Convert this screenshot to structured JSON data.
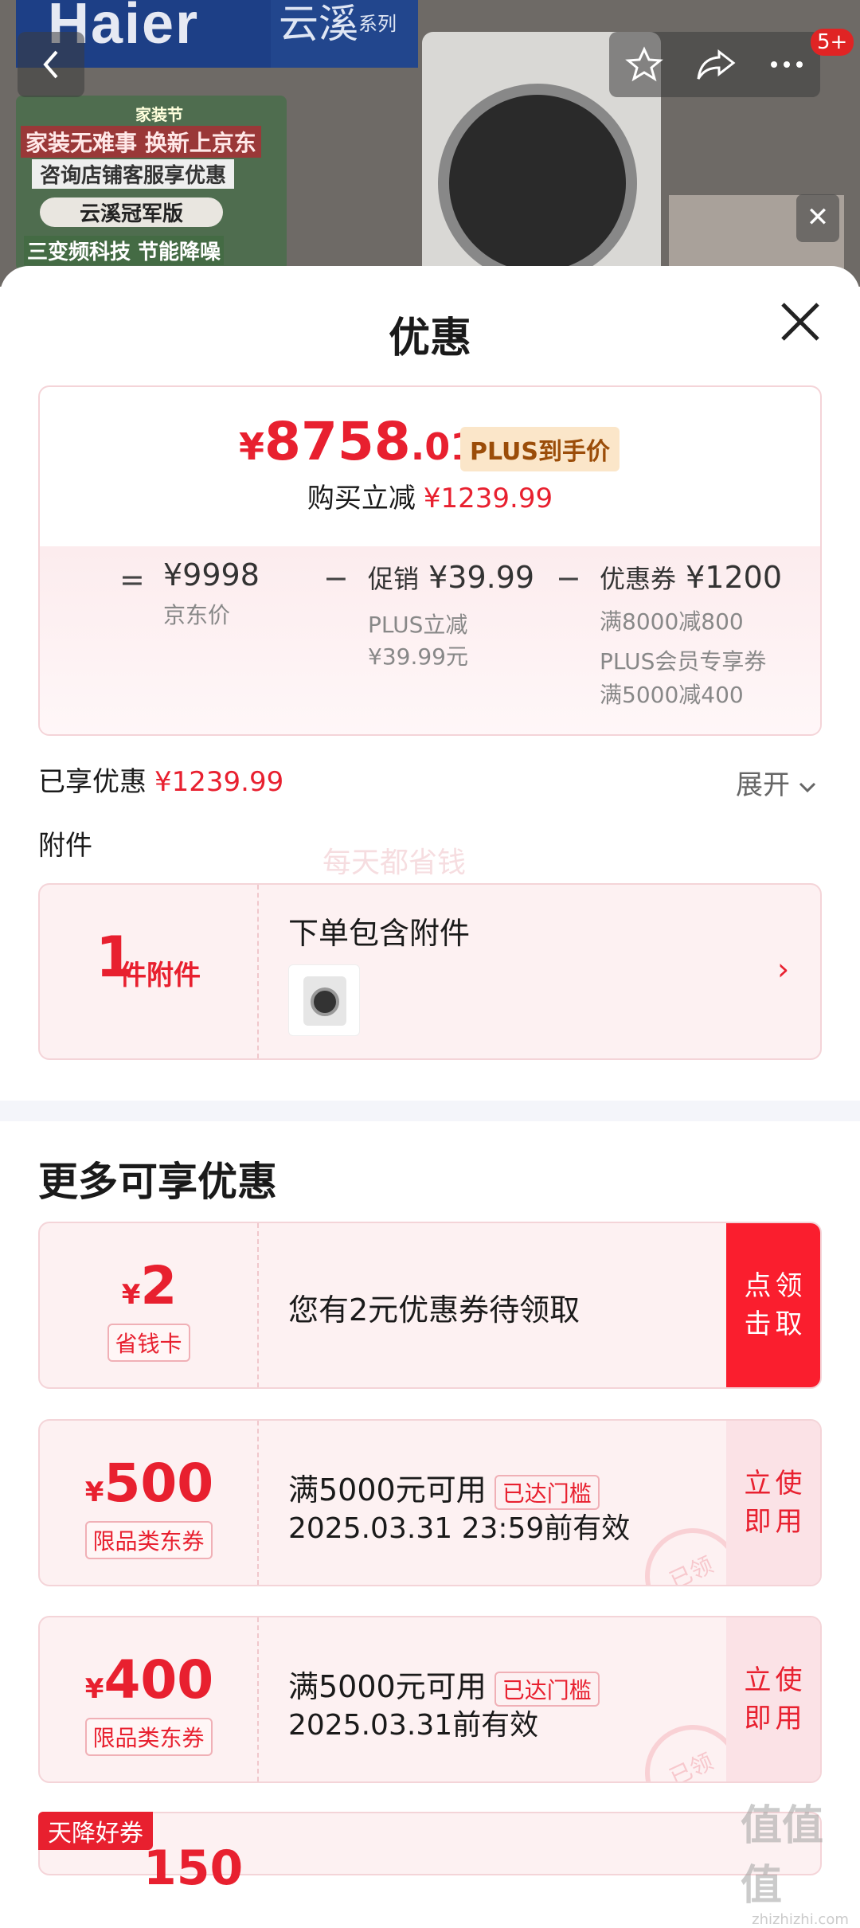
{
  "topbar": {
    "back_icon": "chevron-left-icon",
    "actions": [
      "star-icon",
      "share-icon",
      "more-icon"
    ],
    "message_badge": "5+",
    "banner_brand": "Haier",
    "banner_series": "云溪",
    "banner_series_suffix": "系列",
    "sign_lines": [
      "家装无难事 换新上京东",
      "咨询店铺客服享优惠",
      "云溪冠军版",
      "三变频科技 节能降噪"
    ],
    "sign_top": "家装节"
  },
  "sheet": {
    "title": "优惠",
    "price_card": {
      "currency": "¥",
      "final_int": "8758",
      "final_dec": ".01",
      "plus_tag": "PLUS到手价",
      "save_label": "购买立减",
      "save_value": "¥1239.99",
      "breakdown": {
        "eq": "=",
        "jd_price": "¥9998",
        "jd_price_label": "京东价",
        "minus1": "−",
        "promo_label": "促销",
        "promo_value": "¥39.99",
        "promo_sub1": "PLUS立减",
        "promo_sub2": "¥39.99元",
        "minus2": "−",
        "coupon_label": "优惠券",
        "coupon_value": "¥1200",
        "coupon_sub1": "满8000减800",
        "coupon_sub2": "PLUS会员专享券",
        "coupon_sub3": "满5000减400"
      }
    },
    "enjoyed_label": "已享优惠",
    "enjoyed_value": "¥1239.99",
    "expand_label": "展开",
    "attach_label": "附件",
    "attach_card": {
      "count": "1",
      "unit": "件附件",
      "title": "下单包含附件"
    },
    "watermark": "每天都省钱",
    "more_title": "更多可享优惠",
    "coupons": [
      {
        "symbol": "¥",
        "amount": "2",
        "kind": "省钱卡",
        "text": "您有2元优惠券待领取",
        "reached": "",
        "date": "",
        "action": "点击领取"
      },
      {
        "symbol": "¥",
        "amount": "500",
        "kind": "限品类东券",
        "text": "满5000元可用",
        "reached": "已达门槛",
        "date": "2025.03.31 23:59前有效",
        "action": "立即使用",
        "stamp": "已领"
      },
      {
        "symbol": "¥",
        "amount": "400",
        "kind": "限品类东券",
        "text": "满5000元可用",
        "reached": "已达门槛",
        "date": "2025.03.31前有效",
        "action": "立即使用",
        "stamp": "已领"
      }
    ],
    "sky_tag": "天降好券",
    "last_amount": "150"
  },
  "site_mark": "值值值",
  "site_mark_url": "zhizhizhi.com",
  "colors": {
    "accent": "#e8202f",
    "button_red": "#fa1e2e",
    "card_border": "#f4d4d8"
  }
}
